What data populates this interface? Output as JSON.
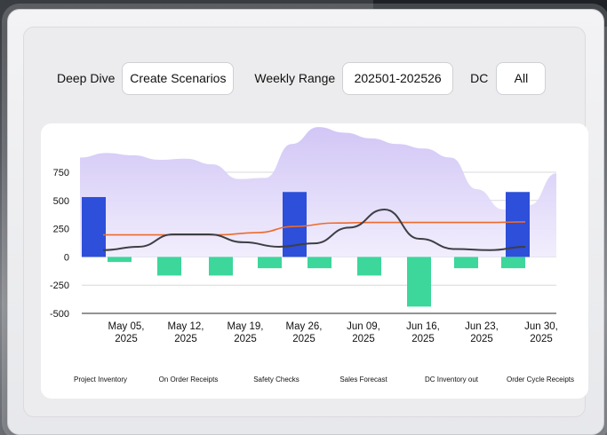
{
  "filters": {
    "deep_dive_label": "Deep Dive",
    "scenario_button": "Create Scenarios",
    "weekly_range_label": "Weekly Range",
    "weekly_range_value": "202501-202526",
    "dc_label": "DC",
    "dc_value": "All"
  },
  "colors": {
    "area": "#d6cdf6",
    "bar_positive": "#2d4fd9",
    "bar_negative": "#3dd69b",
    "line_dark": "#3d3f45",
    "line_orange": "#ee6a2c"
  },
  "chart_data": {
    "type": "bar",
    "ylim": [
      -500,
      750
    ],
    "y_ticks": [
      "750",
      "500",
      "250",
      "0",
      "-250",
      "-500"
    ],
    "y_tick_values": [
      750,
      500,
      250,
      0,
      -250,
      -500
    ],
    "x_labels": [
      [
        "May 05,",
        "2025"
      ],
      [
        "May 12,",
        "2025"
      ],
      [
        "May 19,",
        "2025"
      ],
      [
        "May 26,",
        "2025"
      ],
      [
        "Jun 09,",
        "2025"
      ],
      [
        "Jun 16,",
        "2025"
      ],
      [
        "Jun 23,",
        "2025"
      ],
      [
        "Jun 30,",
        "2025"
      ]
    ],
    "series_legend": [
      "Project Inventory",
      "On Order Receipts",
      "Safety Checks",
      "Sales Forecast",
      "DC Inventory out",
      "Order Cycle Receipts"
    ],
    "positive_bars": [
      530,
      575,
      575
    ],
    "negative_bars": [
      -45,
      -165,
      -165,
      -100,
      -100,
      -165,
      -440,
      -100,
      -100
    ],
    "area": [
      880,
      920,
      900,
      860,
      870,
      820,
      690,
      700,
      1000,
      1150,
      1100,
      1050,
      1000,
      960,
      880,
      600,
      420,
      460,
      740
    ],
    "dark_line": [
      60,
      90,
      200,
      200,
      130,
      90,
      120,
      260,
      420,
      160,
      70,
      60,
      90
    ],
    "orange_line": [
      195,
      195,
      195,
      195,
      215,
      270,
      300,
      305,
      305,
      305,
      305,
      310
    ]
  }
}
